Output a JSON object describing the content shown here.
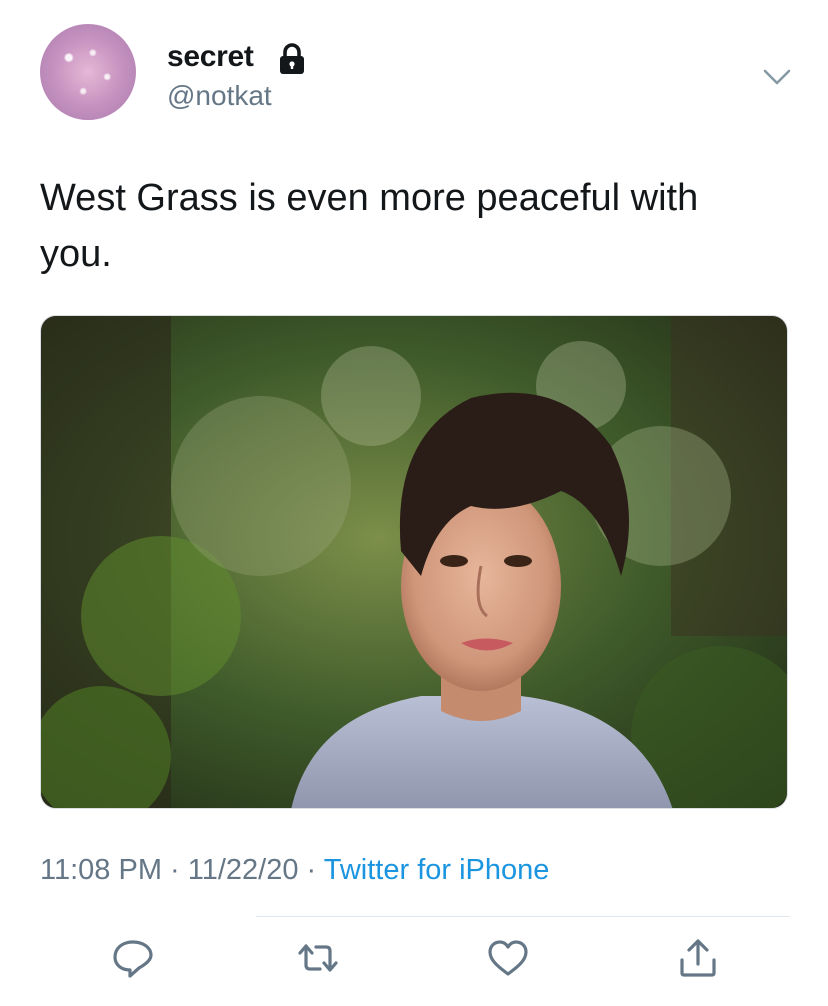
{
  "author": {
    "display_name": "secret",
    "handle": "@notkat",
    "protected_icon": "lock-icon",
    "avatar": "glitter-avatar"
  },
  "tweet": {
    "text": "West Grass is even more peaceful with you.",
    "media": "photo-of-young-man-in-forest"
  },
  "meta": {
    "time": "11:08 PM",
    "separator": " · ",
    "date": "11/22/20",
    "source": "Twitter for iPhone"
  },
  "actions": [
    {
      "icon": "reply-icon"
    },
    {
      "icon": "retweet-icon"
    },
    {
      "icon": "like-icon"
    },
    {
      "icon": "share-icon"
    }
  ],
  "colors": {
    "text": "#14171a",
    "secondary": "#657786",
    "link": "#1b95e0",
    "divider": "#e1e8ed"
  }
}
